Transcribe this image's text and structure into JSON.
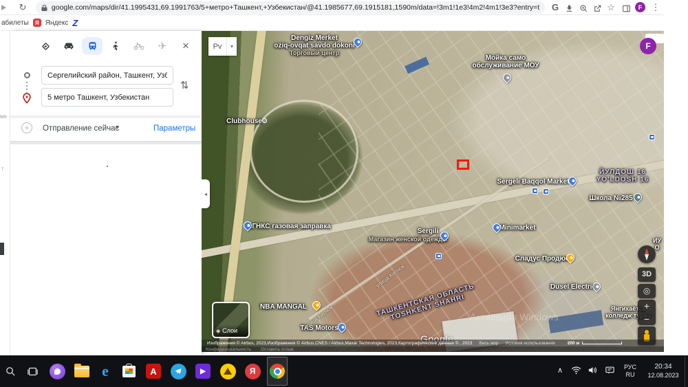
{
  "browser": {
    "url": "google.com/maps/dir/41.1995431,69.1991763/5+метро+Ташкент,+Узбекистан/@41.1985677,69.1915181,1590m/data=!3m1!1e3!4m2!4m1!3e3?entry=ttu",
    "profile_initial": "F",
    "google_button": "G",
    "bookmarks": [
      {
        "label": "абилеты"
      },
      {
        "label": "Яндекс"
      }
    ]
  },
  "panel": {
    "origin_value": "Сергелийский район, Ташкент, Узбеки",
    "destination_value": "5 метро Ташкент, Узбекистан",
    "departure_label": "Отправление сейчас",
    "options_label": "Параметры",
    "edge_fragments": [
      "ме",
      "т"
    ]
  },
  "map": {
    "pv": "Pv",
    "three_d": "3D",
    "layers_label": "Слои",
    "scale_label": "200 м",
    "logo": "Google",
    "watermark": "Активация Windows",
    "account_initial": "F",
    "attribution": "Изображения © Airbus, 2023,Изображения © Airbus,CNES / Airbus,Maxar Technologies, 2023,Картографические данные © , 2023",
    "world_link": "Весь мир",
    "terms_link": "Условия использования",
    "privacy_link": "Конфиденциальность",
    "feedback_link": "Оставить отзыв",
    "labels": [
      {
        "text": "Dengiz Merket",
        "sub": "oziq-ovqat savdo dokoni",
        "sub2": "Торговый центр"
      },
      {
        "text": "Мойка само",
        "sub": "обслуживание МОУ"
      },
      {
        "text": "Clubhouse"
      },
      {
        "text": "Sergeli Baqqol Market"
      },
      {
        "text": "ЙУЛДОШ 16",
        "sub": "YO'LDOSH 16"
      },
      {
        "text": "Школа №285"
      },
      {
        "text": "АГНКС газовая заправка"
      },
      {
        "text": "Sergili",
        "sub": "Магазин женской одежды"
      },
      {
        "text": "Minimarket"
      },
      {
        "text": "Сладус Продюс"
      },
      {
        "text": "Dusel Electric"
      },
      {
        "text": "NBA MANGAL"
      },
      {
        "text": "TAS Motors"
      },
      {
        "text": "ТАШКЕНТСКАЯ ОБЛАСТЬ",
        "sub": "TOSHKENT SHAHRI"
      },
      {
        "text": "Янгихаётск",
        "sub": "колледж туриз"
      },
      {
        "text": "улица Кипчок"
      },
      {
        "text": "улица Кипчок"
      },
      {
        "text": "ИУ",
        "sub": "О"
      }
    ]
  },
  "icons": {
    "close": "×",
    "caret": "▾",
    "swap": "⇅",
    "menu": "⋮",
    "star": "☆",
    "plane": "✈",
    "reload": "↻",
    "locate": "◎",
    "layers_glyph": "◈",
    "collapse": "◂",
    "plus": "+",
    "minus": "−",
    "tray_expand": "∧",
    "play": "▶"
  },
  "taskbar": {
    "lang_top": "РУС",
    "lang_bottom": "RU",
    "time": "20:34",
    "date": "12.08.2023"
  }
}
